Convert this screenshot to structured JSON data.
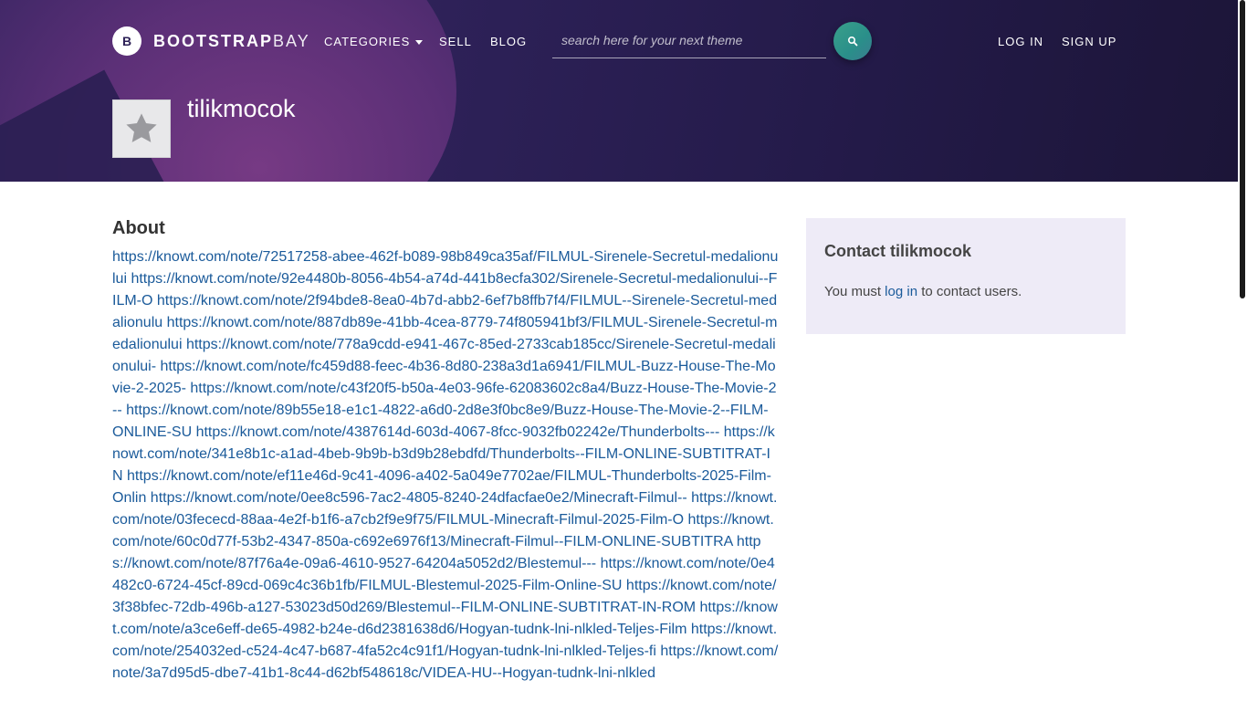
{
  "nav": {
    "brand_bold": "BOOTSTRAP",
    "brand_light": "BAY",
    "logo_letter": "B",
    "categories": "CATEGORIES",
    "sell": "SELL",
    "blog": "BLOG",
    "search_placeholder": "search here for your next theme",
    "login": "LOG IN",
    "signup": "SIGN UP"
  },
  "profile": {
    "username": "tilikmocok",
    "avatar_icon": "star-icon"
  },
  "about": {
    "title": "About",
    "text": "https://knowt.com/note/72517258-abee-462f-b089-98b849ca35af/FILMUL-Sirenele-Secretul-medalionului https://knowt.com/note/92e4480b-8056-4b54-a74d-441b8ecfa302/Sirenele-Secretul-medalionului--FILM-O https://knowt.com/note/2f94bde8-8ea0-4b7d-abb2-6ef7b8ffb7f4/FILMUL--Sirenele-Secretul-medalionulu https://knowt.com/note/887db89e-41bb-4cea-8779-74f805941bf3/FILMUL-Sirenele-Secretul-medalionului https://knowt.com/note/778a9cdd-e941-467c-85ed-2733cab185cc/Sirenele-Secretul-medalionului- https://knowt.com/note/fc459d88-feec-4b36-8d80-238a3d1a6941/FILMUL-Buzz-House-The-Movie-2-2025- https://knowt.com/note/c43f20f5-b50a-4e03-96fe-62083602c8a4/Buzz-House-The-Movie-2-- https://knowt.com/note/89b55e18-e1c1-4822-a6d0-2d8e3f0bc8e9/Buzz-House-The-Movie-2--FILM-ONLINE-SU https://knowt.com/note/4387614d-603d-4067-8fcc-9032fb02242e/Thunderbolts--- https://knowt.com/note/341e8b1c-a1ad-4beb-9b9b-b3d9b28ebdfd/Thunderbolts--FILM-ONLINE-SUBTITRAT-IN https://knowt.com/note/ef11e46d-9c41-4096-a402-5a049e7702ae/FILMUL-Thunderbolts-2025-Film-Onlin https://knowt.com/note/0ee8c596-7ac2-4805-8240-24dfacfae0e2/Minecraft-Filmul-- https://knowt.com/note/03fececd-88aa-4e2f-b1f6-a7cb2f9e9f75/FILMUL-Minecraft-Filmul-2025-Film-O https://knowt.com/note/60c0d77f-53b2-4347-850a-c692e6976f13/Minecraft-Filmul--FILM-ONLINE-SUBTITRA https://knowt.com/note/87f76a4e-09a6-4610-9527-64204a5052d2/Blestemul--- https://knowt.com/note/0e4482c0-6724-45cf-89cd-069c4c36b1fb/FILMUL-Blestemul-2025-Film-Online-SU https://knowt.com/note/3f38bfec-72db-496b-a127-53023d50d269/Blestemul--FILM-ONLINE-SUBTITRAT-IN-ROM https://knowt.com/note/a3ce6eff-de65-4982-b24e-d6d2381638d6/Hogyan-tudnk-lni-nlkled-Teljes-Film https://knowt.com/note/254032ed-c524-4c47-b687-4fa52c4c91f1/Hogyan-tudnk-lni-nlkled-Teljes-fi https://knowt.com/note/3a7d95d5-dbe7-41b1-8c44-d62bf548618c/VIDEA-HU--Hogyan-tudnk-lni-nlkled"
  },
  "contact": {
    "title": "Contact tilikmocok",
    "prefix": "You must",
    "link": "log in",
    "suffix": "to contact users."
  }
}
